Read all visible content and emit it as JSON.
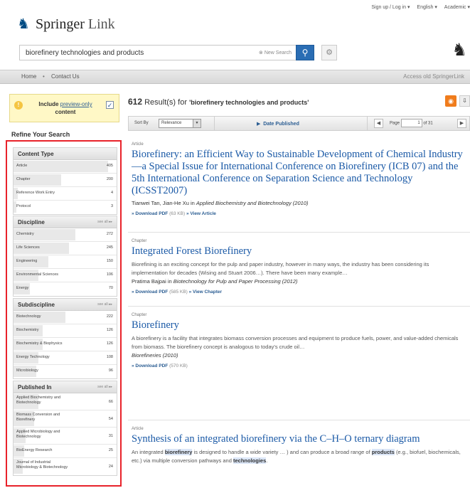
{
  "header": {
    "brand_primary": "Springer",
    "brand_secondary": "Link",
    "signup": "Sign up / Log in ▾",
    "language": "English ▾",
    "academic": "Academic ▾"
  },
  "search": {
    "query": "biorefinery technologies and products",
    "new_search": "New Search",
    "search_icon": "magnifier-icon",
    "settings_icon": "gear-icon"
  },
  "nav": {
    "home": "Home",
    "separator": "•",
    "contact": "Contact Us",
    "old": "Access old SpringerLink"
  },
  "sidebar": {
    "preview_prefix": "Include",
    "preview_link": "preview-only",
    "preview_suffix": "content",
    "preview_checked": "✓",
    "refine_title": "Refine Your Search",
    "see_all": "see all",
    "facets": [
      {
        "title": "Content Type",
        "items": [
          {
            "label": "Article",
            "count": "405"
          },
          {
            "label": "Chapter",
            "count": "200"
          },
          {
            "label": "Reference Work Entry",
            "count": "4"
          },
          {
            "label": "Protocol",
            "count": "3"
          }
        ]
      },
      {
        "title": "Discipline",
        "items": [
          {
            "label": "Chemistry",
            "count": "272"
          },
          {
            "label": "Life Sciences",
            "count": "245"
          },
          {
            "label": "Engineering",
            "count": "150"
          },
          {
            "label": "Environmental Sciences",
            "count": "106"
          },
          {
            "label": "Energy",
            "count": "70"
          }
        ]
      },
      {
        "title": "Subdiscipline",
        "items": [
          {
            "label": "Biotechnology",
            "count": "222"
          },
          {
            "label": "Biochemistry",
            "count": "126"
          },
          {
            "label": "Biochemistry & Biophysics",
            "count": "126"
          },
          {
            "label": "Energy Technology",
            "count": "108"
          },
          {
            "label": "Microbiology",
            "count": "96"
          }
        ]
      },
      {
        "title": "Published In",
        "items": [
          {
            "label": "Applied Biochemistry and Biotechnology",
            "count": "66"
          },
          {
            "label": "Biomass Conversion and Biorefinery",
            "count": "54"
          },
          {
            "label": "Applied Microbiology and Biotechnology",
            "count": "31"
          },
          {
            "label": "BioEnergy Research",
            "count": "25"
          },
          {
            "label": "Journal of Industrial Microbiology & Biotechnology",
            "count": "24"
          }
        ]
      }
    ]
  },
  "results": {
    "count": "612",
    "count_label": "Result(s) for",
    "query_quoted": "'biorefinery technologies and products'",
    "rss_icon": "rss-icon",
    "sort_by": "Sort By",
    "sort_value": "Relevance",
    "date_published": "Date Published",
    "page_label": "Page",
    "page_value": "1",
    "page_of": "of 31",
    "items": [
      {
        "type": "Article",
        "title": "Biorefinery: an Efficient Way to Sustainable Development of Chemical Industry—a Special Issue for International Conference on Biorefinery (ICB 07) and the 5th International Conference on Separation Science and Technology (ICSST2007)",
        "authors": "Tianwei Tan, Jian-He Xu in",
        "source": "Applied Biochemistry and Biotechnology (2010)",
        "download": "» Download PDF",
        "size": "(63 KB)",
        "view": "» View Article"
      },
      {
        "type": "Chapter",
        "title": "Integrated Forest Biorefinery",
        "snippet": "Biorefining is an exciting concept for the pulp and paper industry, however in many ways, the industry has been considering its implementation for decades (Wising and Stuart 2006…). There have been many example…",
        "authors": "Pratima Bajpai in",
        "source": "Biotechnology for Pulp and Paper Processing (2012)",
        "download": "» Download PDF",
        "size": "(585 KB)",
        "view": "» View Chapter"
      },
      {
        "type": "Chapter",
        "title": "Biorefinery",
        "snippet": "A biorefinery is a facility that integrates biomass conversion processes and equipment to produce fuels, power, and value-added chemicals from biomass. The biorefinery concept is analogous to today's crude oil…",
        "source": "Biorefineries (2010)",
        "download": "» Download PDF",
        "size": "(570 KB)"
      },
      {
        "type": "Article",
        "title": "Synthesis of an integrated biorefinery via the C–H–O ternary diagram",
        "snippet_a": "An integrated",
        "snippet_hl1": "biorefinery",
        "snippet_b": "is designed to handle a wide variety … ) and can produce a broad range of",
        "snippet_hl2": "products",
        "snippet_c": "(e.g., biofuel, biochemicals, etc.) via multiple conversion pathways and",
        "snippet_hl3": "technologies",
        "snippet_d": "."
      }
    ]
  }
}
